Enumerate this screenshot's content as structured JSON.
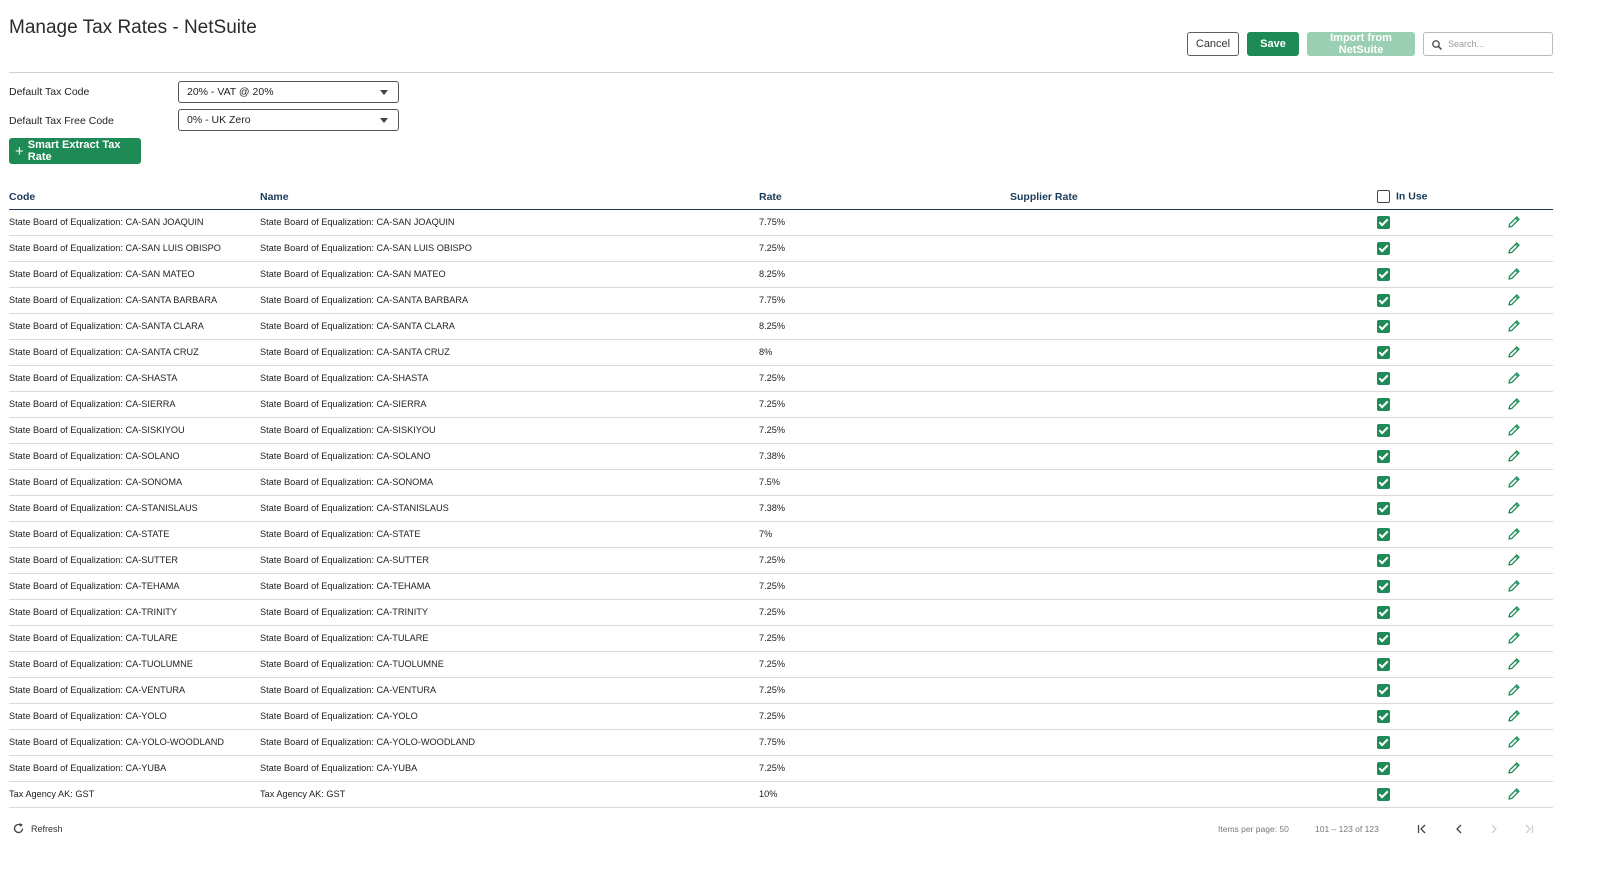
{
  "header": {
    "title": "Manage Tax Rates - NetSuite",
    "cancel_label": "Cancel",
    "save_label": "Save",
    "import_label": "Import from NetSuite",
    "search_placeholder": "Search..."
  },
  "settings": {
    "default_tax_code_label": "Default Tax Code",
    "default_tax_code_value": "20% - VAT @ 20%",
    "default_tax_free_label": "Default Tax Free Code",
    "default_tax_free_value": "0% - UK Zero",
    "smart_extract_label": "Smart Extract Tax Rate"
  },
  "table": {
    "columns": {
      "code": "Code",
      "name": "Name",
      "rate": "Rate",
      "supplier_rate": "Supplier Rate",
      "in_use": "In Use"
    },
    "rows": [
      {
        "code": "State Board of Equalization: CA-SAN JOAQUIN",
        "name": "State Board of Equalization: CA-SAN JOAQUIN",
        "rate": "7.75%",
        "supplier_rate": "",
        "in_use": true
      },
      {
        "code": "State Board of Equalization: CA-SAN LUIS OBISPO",
        "name": "State Board of Equalization: CA-SAN LUIS OBISPO",
        "rate": "7.25%",
        "supplier_rate": "",
        "in_use": true
      },
      {
        "code": "State Board of Equalization: CA-SAN MATEO",
        "name": "State Board of Equalization: CA-SAN MATEO",
        "rate": "8.25%",
        "supplier_rate": "",
        "in_use": true
      },
      {
        "code": "State Board of Equalization: CA-SANTA BARBARA",
        "name": "State Board of Equalization: CA-SANTA BARBARA",
        "rate": "7.75%",
        "supplier_rate": "",
        "in_use": true
      },
      {
        "code": "State Board of Equalization: CA-SANTA CLARA",
        "name": "State Board of Equalization: CA-SANTA CLARA",
        "rate": "8.25%",
        "supplier_rate": "",
        "in_use": true
      },
      {
        "code": "State Board of Equalization: CA-SANTA CRUZ",
        "name": "State Board of Equalization: CA-SANTA CRUZ",
        "rate": "8%",
        "supplier_rate": "",
        "in_use": true
      },
      {
        "code": "State Board of Equalization: CA-SHASTA",
        "name": "State Board of Equalization: CA-SHASTA",
        "rate": "7.25%",
        "supplier_rate": "",
        "in_use": true
      },
      {
        "code": "State Board of Equalization: CA-SIERRA",
        "name": "State Board of Equalization: CA-SIERRA",
        "rate": "7.25%",
        "supplier_rate": "",
        "in_use": true
      },
      {
        "code": "State Board of Equalization: CA-SISKIYOU",
        "name": "State Board of Equalization: CA-SISKIYOU",
        "rate": "7.25%",
        "supplier_rate": "",
        "in_use": true
      },
      {
        "code": "State Board of Equalization: CA-SOLANO",
        "name": "State Board of Equalization: CA-SOLANO",
        "rate": "7.38%",
        "supplier_rate": "",
        "in_use": true
      },
      {
        "code": "State Board of Equalization: CA-SONOMA",
        "name": "State Board of Equalization: CA-SONOMA",
        "rate": "7.5%",
        "supplier_rate": "",
        "in_use": true
      },
      {
        "code": "State Board of Equalization: CA-STANISLAUS",
        "name": "State Board of Equalization: CA-STANISLAUS",
        "rate": "7.38%",
        "supplier_rate": "",
        "in_use": true
      },
      {
        "code": "State Board of Equalization: CA-STATE",
        "name": "State Board of Equalization: CA-STATE",
        "rate": "7%",
        "supplier_rate": "",
        "in_use": true
      },
      {
        "code": "State Board of Equalization: CA-SUTTER",
        "name": "State Board of Equalization: CA-SUTTER",
        "rate": "7.25%",
        "supplier_rate": "",
        "in_use": true
      },
      {
        "code": "State Board of Equalization: CA-TEHAMA",
        "name": "State Board of Equalization: CA-TEHAMA",
        "rate": "7.25%",
        "supplier_rate": "",
        "in_use": true
      },
      {
        "code": "State Board of Equalization: CA-TRINITY",
        "name": "State Board of Equalization: CA-TRINITY",
        "rate": "7.25%",
        "supplier_rate": "",
        "in_use": true
      },
      {
        "code": "State Board of Equalization: CA-TULARE",
        "name": "State Board of Equalization: CA-TULARE",
        "rate": "7.25%",
        "supplier_rate": "",
        "in_use": true
      },
      {
        "code": "State Board of Equalization: CA-TUOLUMNE",
        "name": "State Board of Equalization: CA-TUOLUMNE",
        "rate": "7.25%",
        "supplier_rate": "",
        "in_use": true
      },
      {
        "code": "State Board of Equalization: CA-VENTURA",
        "name": "State Board of Equalization: CA-VENTURA",
        "rate": "7.25%",
        "supplier_rate": "",
        "in_use": true
      },
      {
        "code": "State Board of Equalization: CA-YOLO",
        "name": "State Board of Equalization: CA-YOLO",
        "rate": "7.25%",
        "supplier_rate": "",
        "in_use": true
      },
      {
        "code": "State Board of Equalization: CA-YOLO-WOODLAND",
        "name": "State Board of Equalization: CA-YOLO-WOODLAND",
        "rate": "7.75%",
        "supplier_rate": "",
        "in_use": true
      },
      {
        "code": "State Board of Equalization: CA-YUBA",
        "name": "State Board of Equalization: CA-YUBA",
        "rate": "7.25%",
        "supplier_rate": "",
        "in_use": true
      },
      {
        "code": "Tax Agency AK: GST",
        "name": "Tax Agency AK: GST",
        "rate": "10%",
        "supplier_rate": "",
        "in_use": true
      }
    ]
  },
  "footer": {
    "refresh_label": "Refresh",
    "items_per_page": "Items per page: 50",
    "range": "101 – 123 of 123"
  },
  "icons": {
    "search": "search-icon",
    "plus": "plus-icon",
    "edit": "pencil-icon",
    "refresh": "refresh-icon",
    "first_page": "first-page-icon",
    "prev_page": "chevron-left-icon",
    "next_page": "chevron-right-icon",
    "last_page": "last-page-icon"
  },
  "colors": {
    "accent": "#1e8a55",
    "accent_disabled": "#9bcfb3",
    "header_text": "#1b3a57"
  }
}
